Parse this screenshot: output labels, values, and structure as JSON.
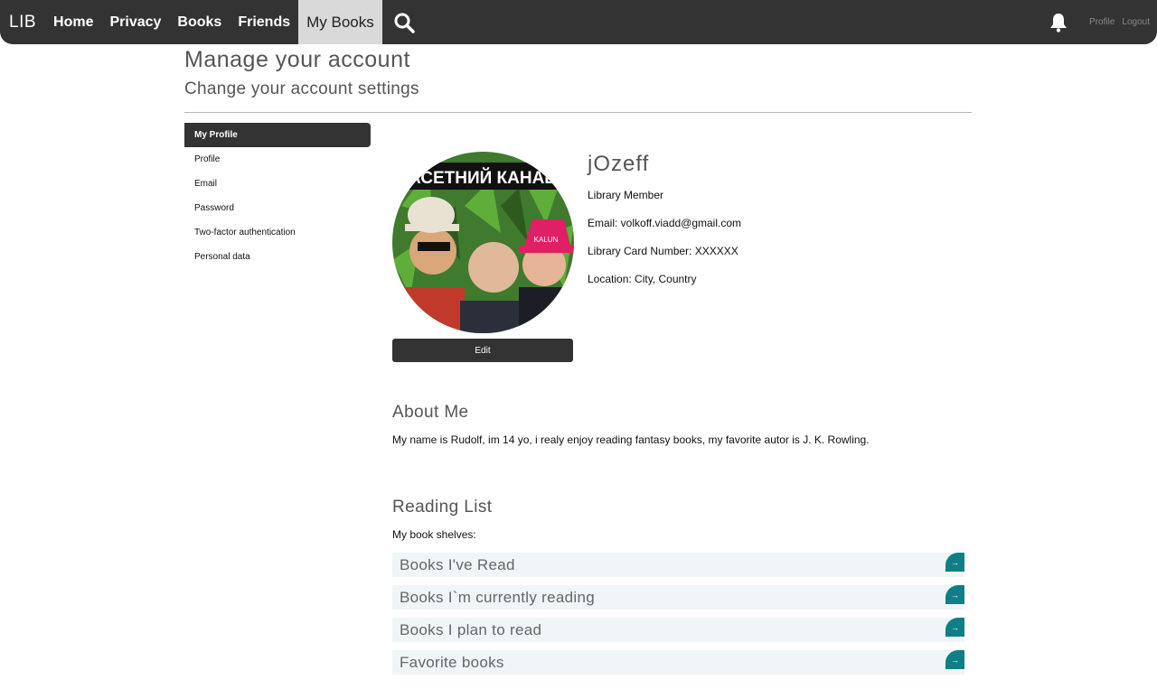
{
  "nav": {
    "brand": "LIB",
    "links": [
      "Home",
      "Privacy",
      "Books",
      "Friends"
    ],
    "active": "My Books",
    "profile": "Profile",
    "logout": "Logout"
  },
  "header": {
    "title": "Manage your account",
    "subtitle": "Change your account settings"
  },
  "sidebar": {
    "items": [
      "My Profile",
      "Profile",
      "Email",
      "Password",
      "Two-factor authentication",
      "Personal data"
    ]
  },
  "profile": {
    "username": "jOzeff",
    "role": "Library Member",
    "email": "Email: volkoff.viadd@gmail.com",
    "card": "Library Card Number: XXXXXX",
    "location": "Location: City, Country",
    "edit_label": "Edit",
    "avatar_caption": "АСЕТНИЙ КАНАВ",
    "hat_text": "KALUN"
  },
  "about": {
    "title": "About Me",
    "text": "My name is Rudolf, im 14 yo, i realy enjoy reading fantasy books, my favorite autor is J. K. Rowling."
  },
  "reading": {
    "title": "Reading List",
    "subtitle": "My book shelves:",
    "shelves": [
      "Books I've Read",
      "Books I`m currently reading",
      "Books I plan to read",
      "Favorite books"
    ],
    "arrow": "→"
  },
  "colors": {
    "navbar": "#333333",
    "accent": "#0e7f87",
    "shelf_bg": "#f0f5f7"
  },
  "icons": {
    "search": "search-icon",
    "bell": "bell-icon",
    "arrow": "arrow-right-icon"
  }
}
